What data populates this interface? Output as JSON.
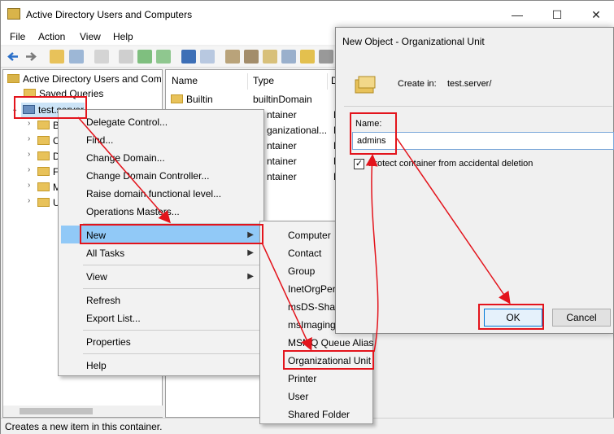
{
  "window": {
    "title": "Active Directory Users and Computers",
    "controls": {
      "minimize": "—",
      "maximize": "☐",
      "close": "✕"
    }
  },
  "menu": [
    "File",
    "Action",
    "View",
    "Help"
  ],
  "tree": {
    "root": "Active Directory Users and Com",
    "saved_queries": "Saved Queries",
    "domain": "test.server",
    "children": [
      "B",
      "C",
      "D",
      "F",
      "M",
      "U"
    ]
  },
  "list": {
    "columns": [
      "Name",
      "Type",
      "D"
    ],
    "rows": [
      {
        "name": "Builtin",
        "type": "builtinDomain",
        "desc": ""
      },
      {
        "name": "",
        "type": "ntainer",
        "desc": "D"
      },
      {
        "name": "",
        "type": "ganizational...",
        "desc": "D"
      },
      {
        "name": "",
        "type": "ntainer",
        "desc": "D"
      },
      {
        "name": "",
        "type": "ntainer",
        "desc": "D"
      },
      {
        "name": "",
        "type": "ntainer",
        "desc": "D"
      }
    ]
  },
  "context_menu": {
    "items": [
      "Delegate Control...",
      "Find...",
      "Change Domain...",
      "Change Domain Controller...",
      "Raise domain functional level...",
      "Operations Masters...",
      "New",
      "All Tasks",
      "View",
      "Refresh",
      "Export List...",
      "Properties",
      "Help"
    ]
  },
  "submenu": {
    "items": [
      "Computer",
      "Contact",
      "Group",
      "InetOrgPer",
      "msDS-Shad",
      "msImaging",
      "MSMQ Queue Alias",
      "Organizational Unit",
      "Printer",
      "User",
      "Shared Folder"
    ]
  },
  "dialog": {
    "title": "New Object - Organizational Unit",
    "create_in_label": "Create in:",
    "create_in_value": "test.server/",
    "name_label": "Name:",
    "name_value": "admins",
    "protect_label": "Protect container from accidental deletion",
    "protect_checked": true,
    "ok": "OK",
    "cancel": "Cancel"
  },
  "status": "Creates a new item in this container.",
  "colors": {
    "highlight": "#91c9f7",
    "annotation": "#e3141c",
    "accent": "#0078d7"
  }
}
